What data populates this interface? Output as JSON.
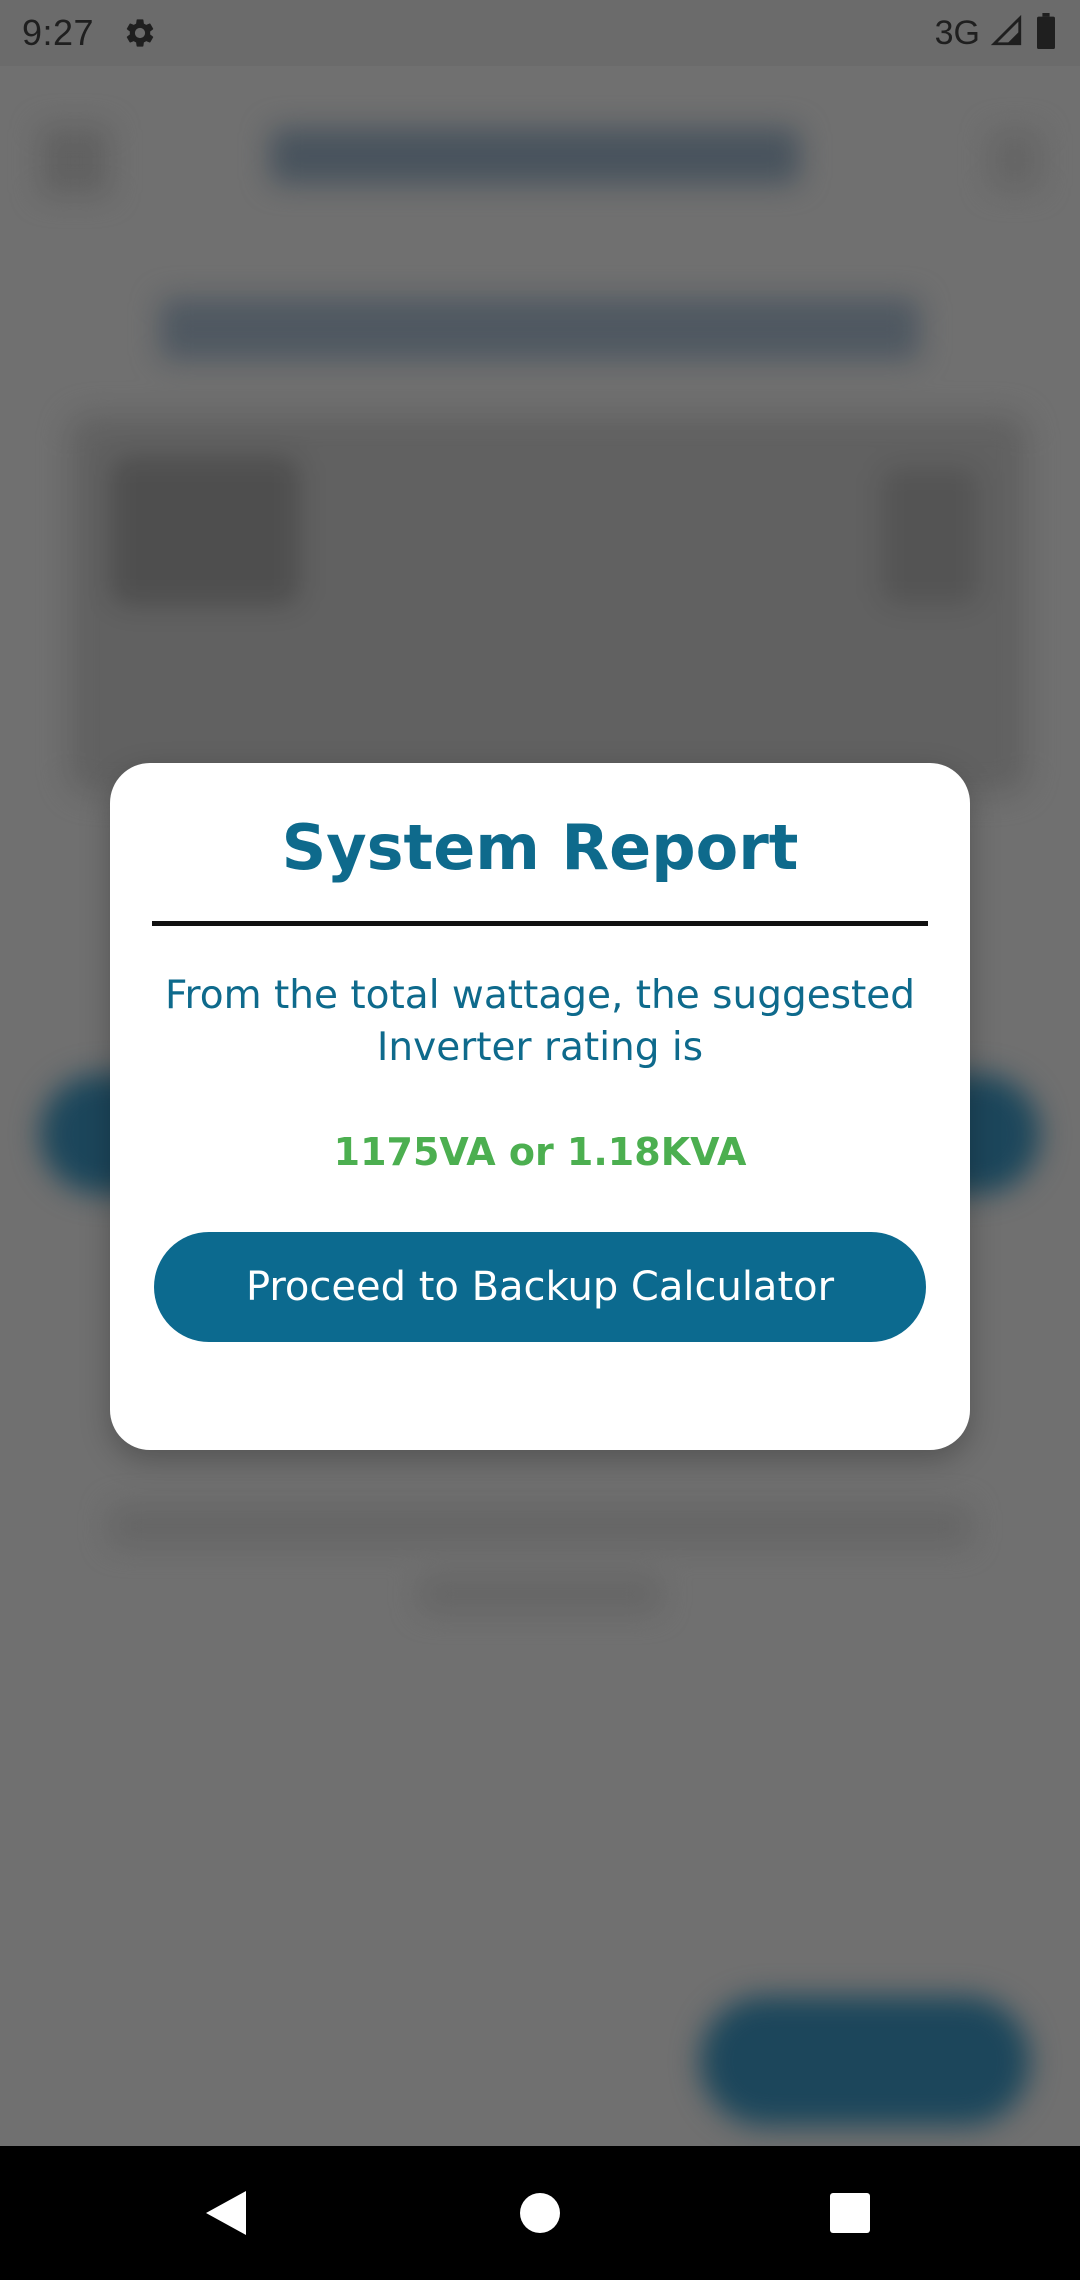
{
  "status_bar": {
    "time": "9:27",
    "network": "3G",
    "icons": [
      "gear-icon",
      "signal-icon",
      "battery-icon"
    ]
  },
  "dialog": {
    "title": "System Report",
    "message": "From the total wattage, the suggested Inverter rating is",
    "rating": "1175VA or 1.18KVA",
    "button_label": "Proceed to Backup Calculator"
  },
  "nav_bar": {
    "icons": [
      "back-icon",
      "home-icon",
      "recents-icon"
    ]
  },
  "colors": {
    "primary": "#0c6a8f",
    "title_text": "#0e6a8c",
    "rating_green": "#4caf50",
    "dialog_bg": "#ffffff",
    "scrim": "#7a7a7a"
  }
}
